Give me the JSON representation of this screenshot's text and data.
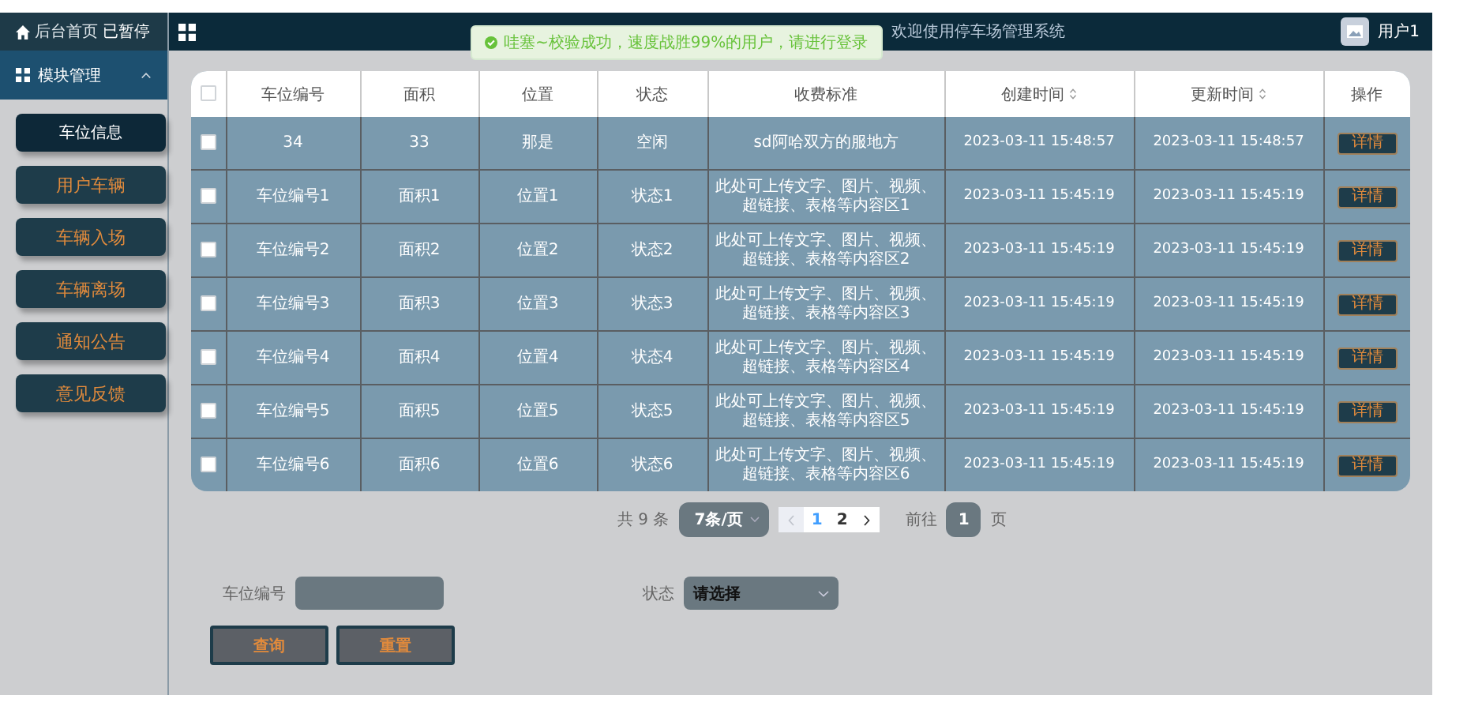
{
  "sidebar": {
    "home_label": "后台首页",
    "paused_label": "已暂停",
    "section": {
      "label": "模块管理",
      "expanded": true
    },
    "items": [
      {
        "label": "车位信息",
        "selected": true
      },
      {
        "label": "用户车辆",
        "selected": false
      },
      {
        "label": "车辆入场",
        "selected": false
      },
      {
        "label": "车辆离场",
        "selected": false
      },
      {
        "label": "通知公告",
        "selected": false
      },
      {
        "label": "意见反馈",
        "selected": false
      }
    ]
  },
  "header": {
    "title": "欢迎使用停车场管理系统",
    "user": "用户1"
  },
  "toast": {
    "message": "哇塞~校验成功，速度战胜99%的用户，请进行登录"
  },
  "table": {
    "all_checked": false,
    "columns": [
      {
        "label": "车位编号",
        "sortable": false
      },
      {
        "label": "面积",
        "sortable": false
      },
      {
        "label": "位置",
        "sortable": false
      },
      {
        "label": "状态",
        "sortable": false
      },
      {
        "label": "收费标准",
        "sortable": false
      },
      {
        "label": "创建时间",
        "sortable": true
      },
      {
        "label": "更新时间",
        "sortable": true
      },
      {
        "label": "操作",
        "sortable": false
      }
    ],
    "rows": [
      {
        "checked": false,
        "cells": [
          "34",
          "33",
          "那是",
          "空闲",
          "sd阿哈双方的服地方",
          "2023-03-11 15:48:57",
          "2023-03-11 15:48:57"
        ],
        "action": "详情"
      },
      {
        "checked": false,
        "cells": [
          "车位编号1",
          "面积1",
          "位置1",
          "状态1",
          "此处可上传文字、图片、视频、超链接、表格等内容区1",
          "2023-03-11 15:45:19",
          "2023-03-11 15:45:19"
        ],
        "action": "详情"
      },
      {
        "checked": false,
        "cells": [
          "车位编号2",
          "面积2",
          "位置2",
          "状态2",
          "此处可上传文字、图片、视频、超链接、表格等内容区2",
          "2023-03-11 15:45:19",
          "2023-03-11 15:45:19"
        ],
        "action": "详情"
      },
      {
        "checked": false,
        "cells": [
          "车位编号3",
          "面积3",
          "位置3",
          "状态3",
          "此处可上传文字、图片、视频、超链接、表格等内容区3",
          "2023-03-11 15:45:19",
          "2023-03-11 15:45:19"
        ],
        "action": "详情"
      },
      {
        "checked": false,
        "cells": [
          "车位编号4",
          "面积4",
          "位置4",
          "状态4",
          "此处可上传文字、图片、视频、超链接、表格等内容区4",
          "2023-03-11 15:45:19",
          "2023-03-11 15:45:19"
        ],
        "action": "详情"
      },
      {
        "checked": false,
        "cells": [
          "车位编号5",
          "面积5",
          "位置5",
          "状态5",
          "此处可上传文字、图片、视频、超链接、表格等内容区5",
          "2023-03-11 15:45:19",
          "2023-03-11 15:45:19"
        ],
        "action": "详情"
      },
      {
        "checked": false,
        "cells": [
          "车位编号6",
          "面积6",
          "位置6",
          "状态6",
          "此处可上传文字、图片、视频、超链接、表格等内容区6",
          "2023-03-11 15:45:19",
          "2023-03-11 15:45:19"
        ],
        "action": "详情"
      }
    ]
  },
  "pagination": {
    "total": "共 9 条",
    "page_size": "7条/页",
    "prev_disabled": true,
    "next_disabled": false,
    "pages": [
      {
        "label": "1",
        "selected": true
      },
      {
        "label": "2",
        "selected": false
      }
    ],
    "goto_label": "前往",
    "goto_value": "1",
    "page_suffix": "页"
  },
  "filters": [
    {
      "kind": "input",
      "label": "车位编号"
    },
    {
      "kind": "select",
      "label": "状态",
      "placeholder": "请选择"
    }
  ],
  "buttons": [
    "查询",
    "重置"
  ]
}
